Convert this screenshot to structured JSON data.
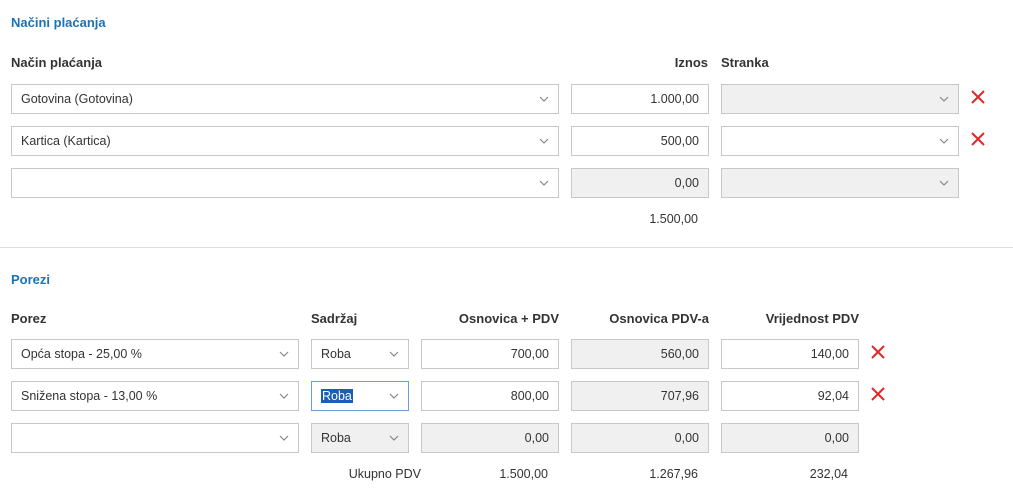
{
  "payments": {
    "title": "Načini plaćanja",
    "headers": {
      "method": "Način plaćanja",
      "amount": "Iznos",
      "party": "Stranka"
    },
    "rows": [
      {
        "method": "Gotovina (Gotovina)",
        "amount": "1.000,00",
        "party": ""
      },
      {
        "method": "Kartica (Kartica)",
        "amount": "500,00",
        "party": ""
      },
      {
        "method": "",
        "amount": "0,00",
        "party": ""
      }
    ],
    "total": "1.500,00"
  },
  "taxes": {
    "title": "Porezi",
    "headers": {
      "tax": "Porez",
      "content": "Sadržaj",
      "base_vat": "Osnovica + PDV",
      "base": "Osnovica PDV-a",
      "vat_value": "Vrijednost PDV"
    },
    "rows": [
      {
        "tax": "Opća stopa - 25,00 %",
        "content": "Roba",
        "base_vat": "700,00",
        "base": "560,00",
        "vat_value": "140,00"
      },
      {
        "tax": "Snižena stopa - 13,00 %",
        "content": "Roba",
        "base_vat": "800,00",
        "base": "707,96",
        "vat_value": "92,04"
      },
      {
        "tax": "",
        "content": "Roba",
        "base_vat": "0,00",
        "base": "0,00",
        "vat_value": "0,00"
      }
    ],
    "totals": {
      "label": "Ukupno PDV",
      "base_vat": "1.500,00",
      "base": "1.267,96",
      "vat_value": "232,04"
    }
  },
  "colors": {
    "accent": "#1a73b8",
    "delete": "#e02828",
    "disabled_bg": "#f0f0f0",
    "border": "#c8c8c8"
  }
}
